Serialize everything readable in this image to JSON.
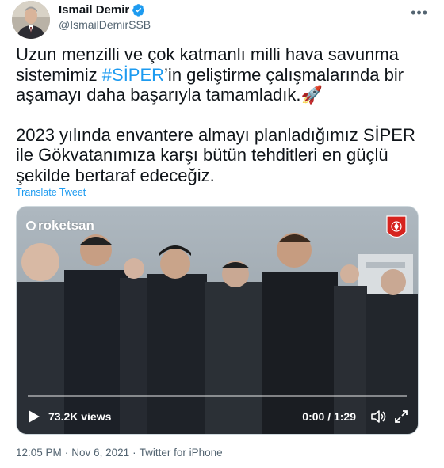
{
  "author": {
    "name": "Ismail Demir",
    "handle": "@IsmailDemirSSB",
    "verified_icon": "verified-badge-icon"
  },
  "more_icon": "more-options-icon",
  "tweet": {
    "p1_before": "Uzun menzilli ve çok katmanlı milli hava savunma sistemimiz ",
    "hashtag": "#SİPER",
    "p1_after": "’in geliştirme çalışmalarında bir aşamayı daha başarıyla tamamladık.",
    "rocket_emoji": "🚀",
    "p2": "2023 yılında envantere almayı planladığımız SİPER ile Gökvatanımıza karşı bütün tehditleri en güçlü şekilde bertaraf edeceğiz."
  },
  "translate_label": "Translate Tweet",
  "video": {
    "brand_text": "roketsan",
    "views": "73.2K views",
    "time": "0:00 / 1:29",
    "progress": 0.0
  },
  "meta": {
    "time": "12:05 PM",
    "date": "Nov 6, 2021",
    "separator": "·",
    "source": "Twitter for iPhone"
  },
  "colors": {
    "accent": "#1d9bf0",
    "text": "#0f1419",
    "secondary": "#536471"
  }
}
